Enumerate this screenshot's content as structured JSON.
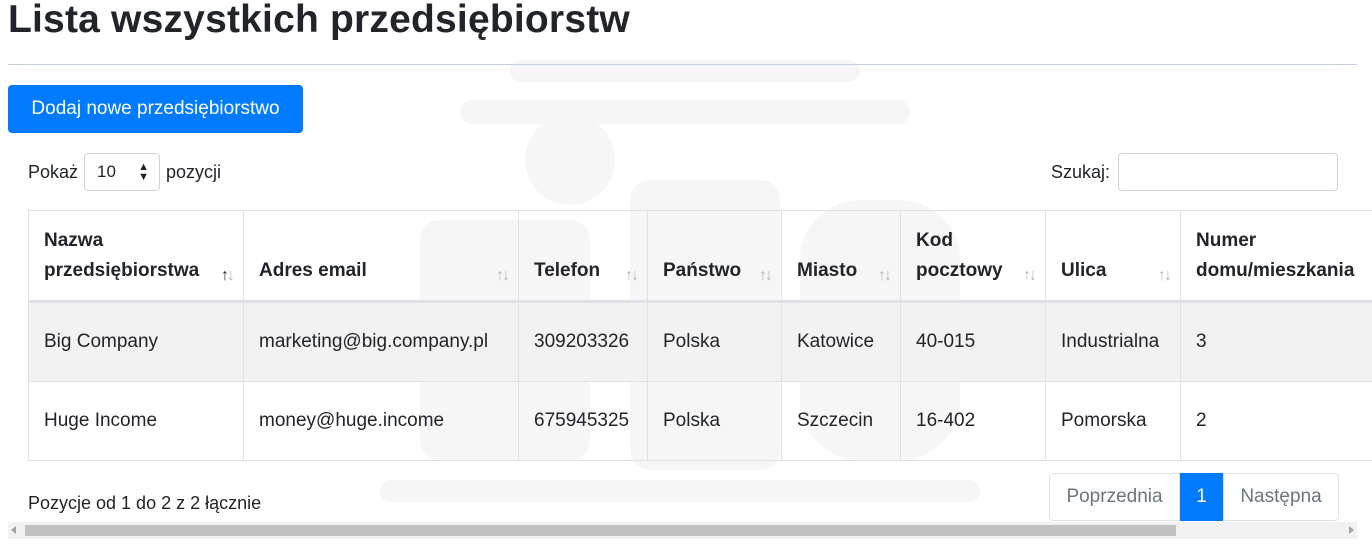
{
  "page": {
    "title": "Lista wszystkich przedsiębiorstw"
  },
  "actions": {
    "add_label": "Dodaj nowe przedsiębiorstwo"
  },
  "length": {
    "prefix": "Pokaż",
    "value": "10",
    "suffix": "pozycji"
  },
  "search": {
    "label": "Szukaj:",
    "value": ""
  },
  "table": {
    "columns": [
      {
        "line1": "Nazwa",
        "line2": "przedsiębiorstwa",
        "sorted": true
      },
      {
        "line1": "",
        "line2": "Adres email",
        "sorted": false
      },
      {
        "line1": "",
        "line2": "Telefon",
        "sorted": false
      },
      {
        "line1": "",
        "line2": "Państwo",
        "sorted": false
      },
      {
        "line1": "",
        "line2": "Miasto",
        "sorted": false
      },
      {
        "line1": "Kod",
        "line2": "pocztowy",
        "sorted": false
      },
      {
        "line1": "",
        "line2": "Ulica",
        "sorted": false
      },
      {
        "line1": "Numer",
        "line2": "domu/mieszkania",
        "sorted": false
      }
    ],
    "rows": [
      [
        "Big Company",
        "marketing@big.company.pl",
        "309203326",
        "Polska",
        "Katowice",
        "40-015",
        "Industrialna",
        "3"
      ],
      [
        "Huge Income",
        "money@huge.income",
        "675945325",
        "Polska",
        "Szczecin",
        "16-402",
        "Pomorska",
        "2"
      ]
    ]
  },
  "info": {
    "text": "Pozycje od 1 do 2 z 2 łącznie"
  },
  "pagination": {
    "prev": "Poprzednia",
    "current": "1",
    "next": "Następna"
  },
  "colors": {
    "primary": "#007bff",
    "row_stripe": "#f2f2f2",
    "border": "#dee2e6"
  }
}
